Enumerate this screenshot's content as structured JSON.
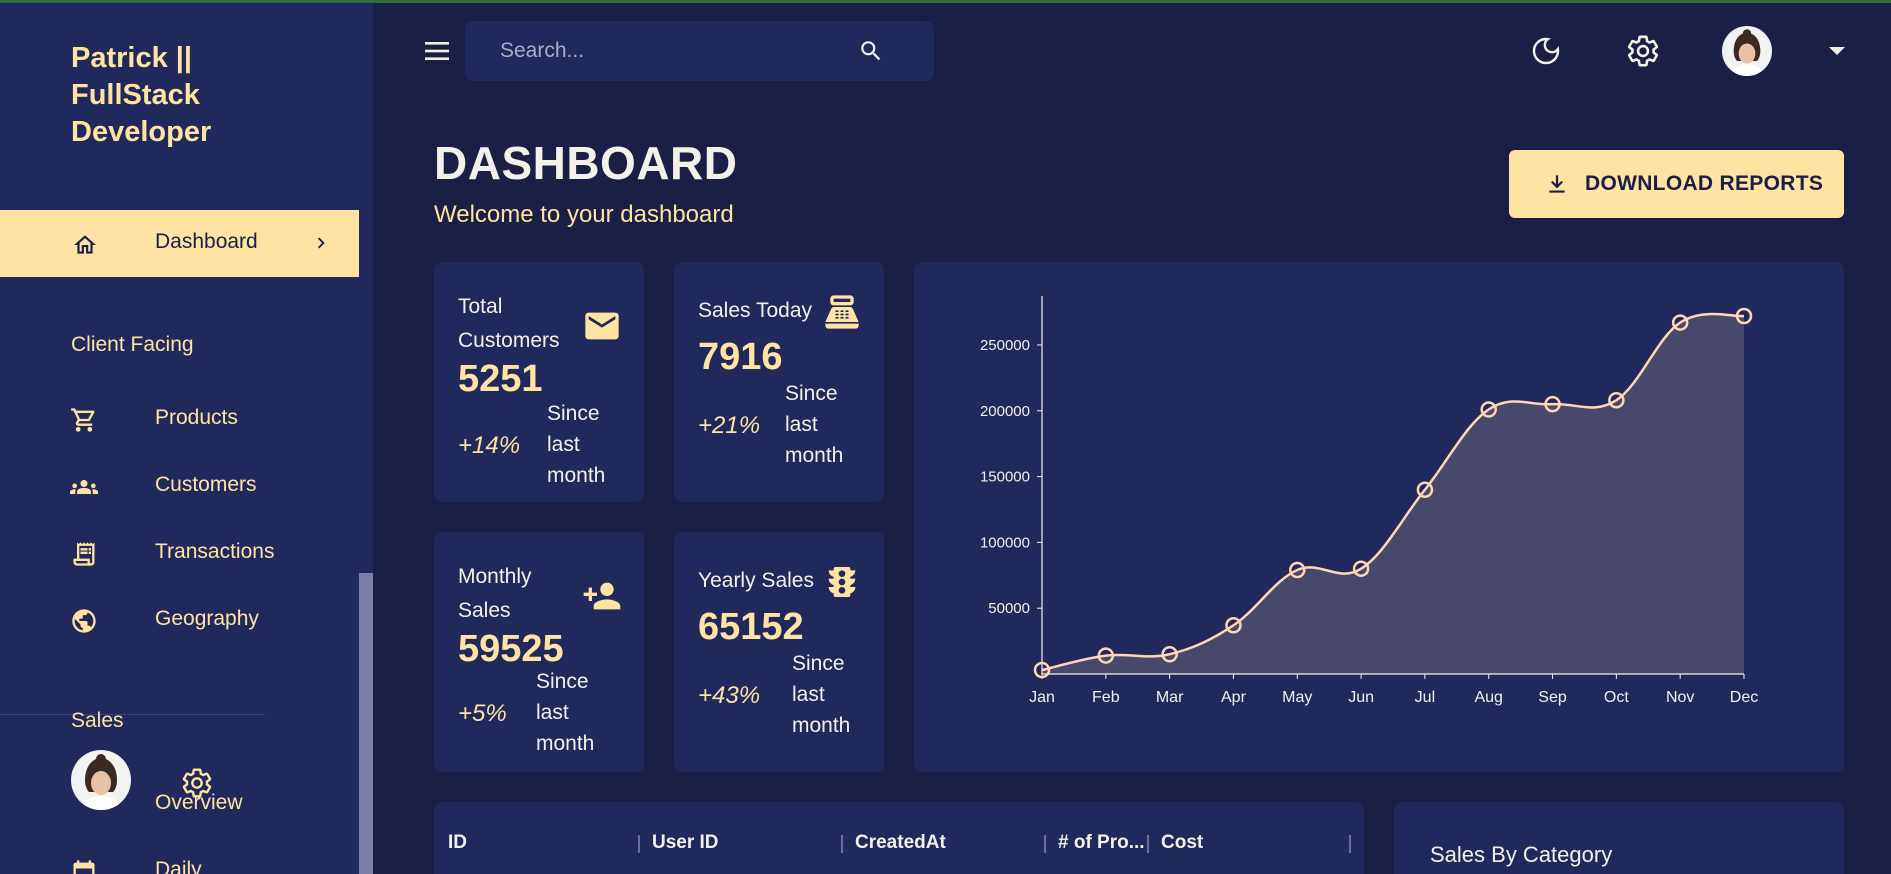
{
  "brand": "Patrick || FullStack Developer",
  "sidebar": {
    "active": {
      "label": "Dashboard"
    },
    "sections": [
      {
        "title": "Client Facing",
        "items": [
          "Products",
          "Customers",
          "Transactions",
          "Geography"
        ]
      },
      {
        "title": "Sales",
        "items": [
          "Overview",
          "Daily"
        ]
      }
    ]
  },
  "topbar": {
    "search_placeholder": "Search..."
  },
  "header": {
    "title": "DASHBOARD",
    "subtitle": "Welcome to your dashboard",
    "download_label": "DOWNLOAD REPORTS"
  },
  "stats": [
    {
      "title": "Total Customers",
      "value": "5251",
      "change": "+14%",
      "since": "Since last month",
      "icon": "email-icon"
    },
    {
      "title": "Sales Today",
      "value": "7916",
      "change": "+21%",
      "since": "Since last month",
      "icon": "point-of-sale-icon"
    },
    {
      "title": "Monthly Sales",
      "value": "59525",
      "change": "+5%",
      "since": "Since last month",
      "icon": "person-add-icon"
    },
    {
      "title": "Yearly Sales",
      "value": "65152",
      "change": "+43%",
      "since": "Since last month",
      "icon": "traffic-icon"
    }
  ],
  "chart_data": {
    "type": "area",
    "categories": [
      "Jan",
      "Feb",
      "Mar",
      "Apr",
      "May",
      "Jun",
      "Jul",
      "Aug",
      "Sep",
      "Oct",
      "Nov",
      "Dec"
    ],
    "values": [
      3000,
      14000,
      15000,
      37000,
      79000,
      80000,
      140000,
      201000,
      205000,
      208000,
      267000,
      272000
    ],
    "yticks": [
      50000,
      100000,
      150000,
      200000,
      250000
    ],
    "ylim": [
      0,
      272000
    ],
    "grid": false,
    "colors": {
      "line": "#ffd8b3",
      "fill": "#4a4a6d"
    }
  },
  "table": {
    "columns": [
      "ID",
      "User ID",
      "CreatedAt",
      "# of Pro...",
      "Cost"
    ]
  },
  "sales_by_category": {
    "title": "Sales By Category"
  },
  "colors": {
    "background": "#1b1f45",
    "panel": "#21295c",
    "accent": "#ffe3a3",
    "text": "#f4f1e8"
  }
}
